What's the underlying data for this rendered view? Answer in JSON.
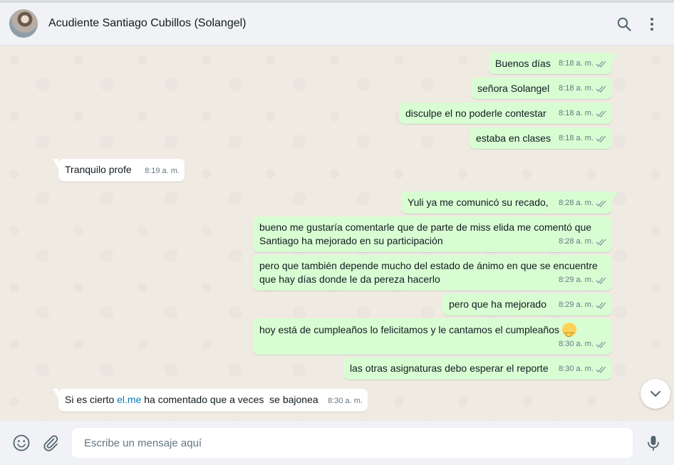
{
  "header": {
    "contact_name": "Acudiente Santiago Cubillos (Solangel)",
    "avatar_icon": "contact-avatar",
    "search_icon": "search-icon",
    "menu_icon": "menu-dots-icon"
  },
  "messages": [
    {
      "dir": "out",
      "text": "Buenos días",
      "time": "8:18 a. m."
    },
    {
      "dir": "out",
      "text": "señora Solangel",
      "time": "8:18 a. m."
    },
    {
      "dir": "out",
      "text": "disculpe el no poderle contestar",
      "time": "8:18 a. m."
    },
    {
      "dir": "out",
      "text": "estaba en clases",
      "time": "8:18 a. m."
    },
    {
      "dir": "in",
      "text": "Tranquilo profe",
      "time": "8:19 a. m."
    },
    {
      "dir": "out",
      "text": "Yuli ya me comunicó su recado,",
      "time": "8:28 a. m."
    },
    {
      "dir": "out",
      "text": "bueno me gustaría comentarle que de parte de miss elida me comentó que Santiago ha mejorado en su participación",
      "time": "8:28 a. m."
    },
    {
      "dir": "out",
      "text": "pero que también depende mucho del estado de ánimo en que se encuentre que hay días donde le da pereza hacerlo",
      "time": "8:29 a. m."
    },
    {
      "dir": "out",
      "text": "pero que ha mejorado",
      "time": "8:29 a. m."
    },
    {
      "dir": "out",
      "text": "hoy está de cumpleaños lo felicitamos y le cantamos el cumpleaños",
      "emoji": "smiling-face-emoji",
      "time": "8:30 a. m."
    },
    {
      "dir": "out",
      "text": "las otras asignaturas debo esperar el reporte",
      "time": "8:30 a. m."
    },
    {
      "dir": "in",
      "text_before": "Si es cierto ",
      "link": "el.me",
      "text_after": " ha comentado que a veces  se bajonea",
      "time": "8:30 a. m."
    }
  ],
  "colors": {
    "outgoing_bubble": "#d9fdd3",
    "incoming_bubble": "#ffffff",
    "chat_background": "#efeae2",
    "header_background": "#f0f2f5",
    "read_ticks": "#8696a0",
    "link": "#027eb5"
  },
  "footer": {
    "emoji_icon": "emoji-icon",
    "attach_icon": "paperclip-icon",
    "placeholder": "Escribe un mensaje aquí",
    "value": "",
    "mic_icon": "microphone-icon"
  },
  "scroll_button_icon": "chevron-down-icon"
}
